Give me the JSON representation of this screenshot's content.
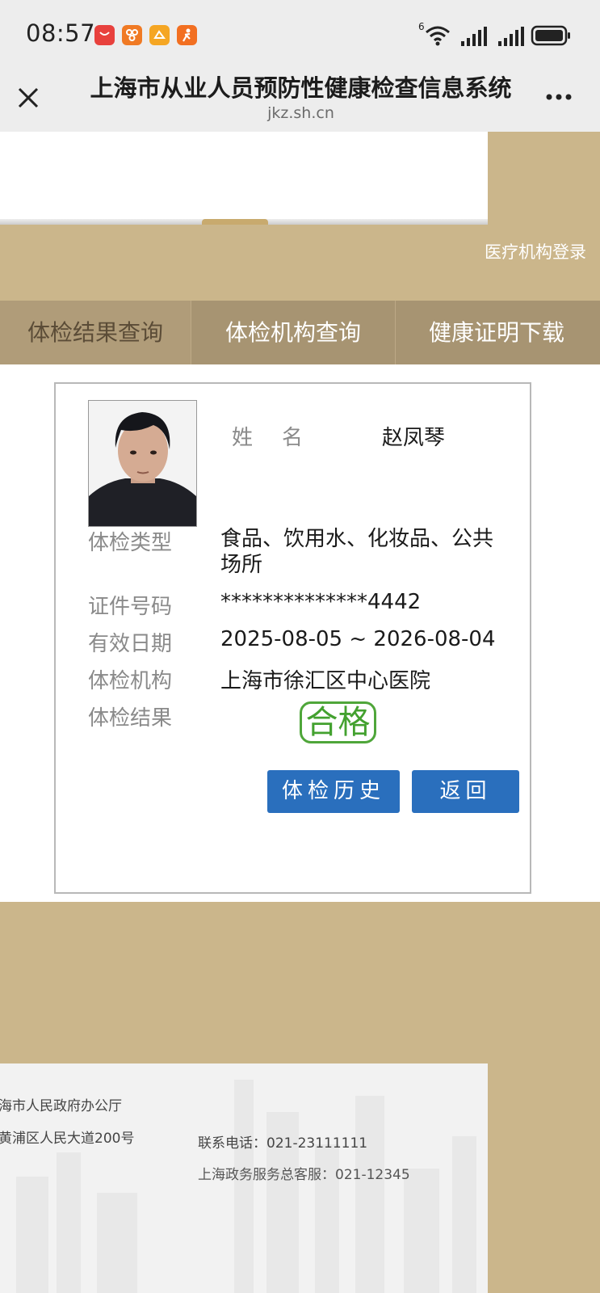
{
  "status_bar": {
    "time": "08:57",
    "apps": [
      {
        "icon": "huawei-store-icon",
        "color": "#e8413d"
      },
      {
        "icon": "app-orange-icon",
        "color": "#f07a24"
      },
      {
        "icon": "app-yellow-icon",
        "color": "#f5a623"
      },
      {
        "icon": "app-runner-icon",
        "color": "#f26f21"
      }
    ],
    "wifi_label": "6"
  },
  "title_bar": {
    "title": "上海市从业人员预防性健康检查信息系统",
    "url": "jkz.sh.cn"
  },
  "header": {
    "login_link": "医疗机构登录"
  },
  "nav": {
    "tabs": [
      {
        "label": "体检结果查询",
        "active": true
      },
      {
        "label": "体检机构查询",
        "active": false
      },
      {
        "label": "健康证明下载",
        "active": false
      }
    ]
  },
  "card": {
    "name_label": "姓名",
    "name_value": "赵凤琴",
    "type_label": "体检类型",
    "type_value": "食品、饮用水、化妆品、公共场所",
    "id_label": "证件号码",
    "id_value": "**************4442",
    "date_label": "有效日期",
    "date_value": "2025-08-05 ~ 2026-08-04",
    "inst_label": "体检机构",
    "inst_value": "上海市徐汇区中心医院",
    "result_label": "体检结果",
    "result_value": "合格",
    "history_button": "体检历史",
    "back_button": "返回"
  },
  "footer": {
    "office": "海市人民政府办公厅",
    "address": "黄浦区人民大道200号",
    "phone": "联系电话：021-23111111",
    "service": "上海政务服务总客服：021-12345"
  },
  "colors": {
    "gold": "#cbb68b",
    "nav": "#a79472",
    "button_blue": "#2a6fbd",
    "stamp_green": "#43a12f"
  }
}
